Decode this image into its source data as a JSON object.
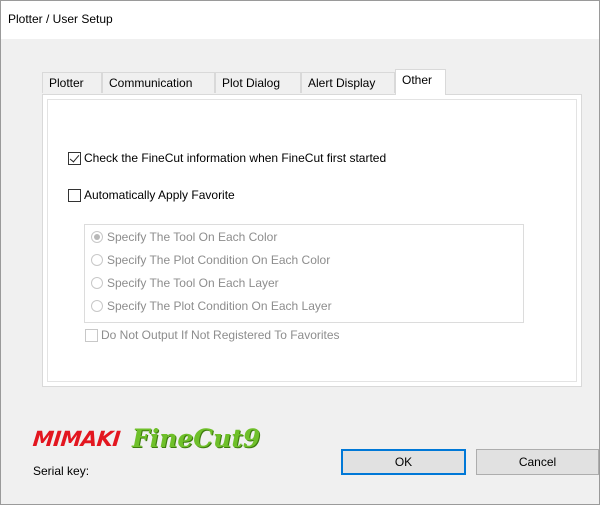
{
  "window": {
    "title": "Plotter / User Setup"
  },
  "tabs": [
    {
      "label": "Plotter"
    },
    {
      "label": "Communication"
    },
    {
      "label": "Plot Dialog"
    },
    {
      "label": "Alert Display"
    },
    {
      "label": "Other",
      "active": true
    }
  ],
  "other_tab": {
    "check_finecut_info": {
      "label": "Check the FineCut information when FineCut first started",
      "checked": true
    },
    "auto_apply_favorite": {
      "label": "Automatically Apply Favorite",
      "checked": false
    },
    "favorite_options": [
      {
        "label": "Specify The Tool On Each Color",
        "selected": true,
        "enabled": false
      },
      {
        "label": "Specify The Plot Condition On Each Color",
        "selected": false,
        "enabled": false
      },
      {
        "label": "Specify The Tool On Each Layer",
        "selected": false,
        "enabled": false
      },
      {
        "label": "Specify The Plot Condition On Each Layer",
        "selected": false,
        "enabled": false
      }
    ],
    "do_not_output": {
      "label": "Do Not Output If Not Registered To Favorites",
      "checked": false,
      "enabled": false
    }
  },
  "footer": {
    "logo_brand": "MIMAKI",
    "logo_product": "FineCut9",
    "serial_key_label": "Serial key:",
    "ok_label": "OK",
    "cancel_label": "Cancel"
  },
  "colors": {
    "mimaki_red": "#e3161f",
    "finecut_green": "#6fc02a",
    "default_button_border": "#0078d7",
    "disabled_text": "#8d8d8d"
  }
}
